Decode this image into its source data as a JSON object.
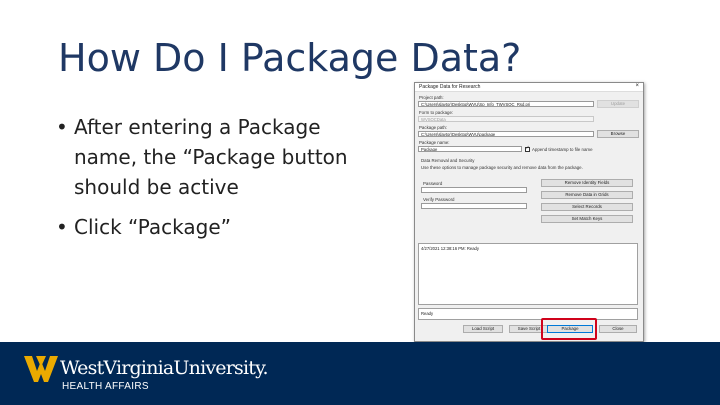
{
  "slide": {
    "title": "How Do I Package Data?",
    "bullets": [
      "After entering a Package name, the “Package button should be active",
      "Click “Package”"
    ],
    "bullet_glyph": "•"
  },
  "dialog": {
    "title": "Package Data for Research",
    "close_glyph": "×",
    "project_path_label": "Project path:",
    "project_path_value": "C:\\Users\\slaytor\\Desktop\\WVU\\Sp_Info_TWVSOC_Rsd.prj",
    "update_button": "Update",
    "form_label": "Form to package:",
    "form_value": "WVSOCData",
    "package_path_label": "Package path:",
    "package_path_value": "C:\\Users\\slaytor\\Desktop\\WVU\\package",
    "browse_button": "Browse",
    "package_name_label": "Package name:",
    "package_name_value": "Package",
    "append_timestamp_label": "Append timestamp to file name",
    "section_title": "Data Removal and Security",
    "section_desc": "Use these options to manage package security and remove data from the package.",
    "password_label": "Password",
    "verify_password_label": "Verify Password",
    "remove_identity_button": "Remove Identity Fields",
    "remove_grids_button": "Remove Data in Grids",
    "select_records_button": "Select Records",
    "set_match_keys_button": "Set Match Keys",
    "log_entry": "4/27/2021 12:38:16 PM: Ready",
    "status_text": "Ready",
    "load_script_button": "Load Script",
    "save_script_button": "Save Script",
    "package_button": "Package",
    "close_button": "Close"
  },
  "footer": {
    "university_name": "WestVirginiaUniversity.",
    "subtitle": "HEALTH AFFAIRS"
  },
  "colors": {
    "title": "#1f3864",
    "footer_bg": "#002855",
    "logo_gold": "#eaaa00",
    "highlight": "#d0021b"
  }
}
